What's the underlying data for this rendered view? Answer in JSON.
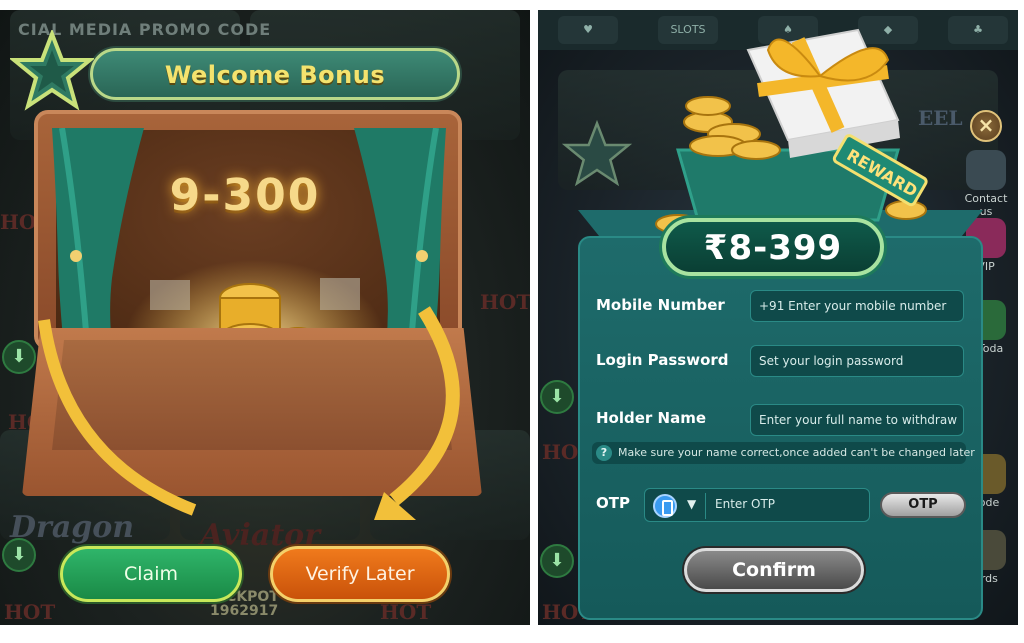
{
  "left_panel": {
    "background_text": {
      "promo": "CIAL MEDIA PROMO CODE",
      "hot": "HOT",
      "dragon": "Dragon",
      "aviator": "Aviator",
      "jackpot_label": "JACKPOT",
      "jackpot_value": "1962917"
    },
    "title": "Welcome Bonus",
    "bonus_range": "9-300",
    "buttons": {
      "claim": "Claim",
      "verify_later": "Verify Later"
    },
    "colors": {
      "claim": "#1f9a54",
      "verify_later": "#e06a14",
      "title_text": "#f4e36e"
    }
  },
  "right_panel": {
    "background_text": {
      "slots": "SLOTS",
      "contact": "Contact us",
      "vip": "VIP",
      "today": "s Toda",
      "code": "code",
      "cards": "ords",
      "hot": "HOT",
      "fee": "EEL"
    },
    "reward_tag": "REWARD",
    "reward_amount": "₹8-399",
    "close_icon": "close-icon",
    "fields": {
      "mobile_label": "Mobile Number",
      "mobile_placeholder": "+91  Enter your mobile number",
      "password_label": "Login Password",
      "password_placeholder": "Set your login password",
      "holder_label": "Holder Name",
      "holder_placeholder": "Enter your full name to withdraw",
      "hint": "Make sure your name correct,once added can't be changed later",
      "otp_label": "OTP",
      "otp_placeholder": "Enter OTP",
      "otp_button": "OTP",
      "confirm": "Confirm"
    },
    "colors": {
      "form_bg": "#1a6363",
      "input_bg": "#0f4a4a",
      "confirm": "#6a6a6a"
    }
  }
}
